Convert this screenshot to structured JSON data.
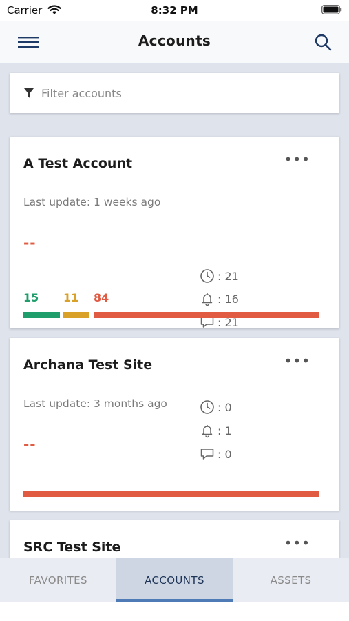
{
  "status_bar": {
    "carrier": "Carrier",
    "time": "8:32 PM"
  },
  "nav": {
    "title": "Accounts"
  },
  "filter": {
    "placeholder": "Filter accounts"
  },
  "cards": [
    {
      "title": "A Test Account",
      "update": "Last update: 1 weeks ago",
      "dash": "--",
      "clock": ": 21",
      "bell": ": 16",
      "chat": ": 21",
      "counts": [
        {
          "value": "15",
          "color": "#1f9e6b"
        },
        {
          "value": "11",
          "color": "#d9a127"
        },
        {
          "value": "84",
          "color": "#e15b43"
        }
      ]
    },
    {
      "title": "Archana Test Site",
      "update": "Last update: 3 months ago",
      "dash": "--",
      "clock": ": 0",
      "bell": ": 1",
      "chat": ": 0"
    },
    {
      "title": "SRC Test Site"
    }
  ],
  "tabs": [
    {
      "label": "FAVORITES"
    },
    {
      "label": "ACCOUNTS"
    },
    {
      "label": "ASSETS"
    }
  ],
  "colors": {
    "green": "#1f9e6b",
    "yellow": "#d9a127",
    "red": "#e15b43",
    "accent": "#4e7bb5"
  }
}
